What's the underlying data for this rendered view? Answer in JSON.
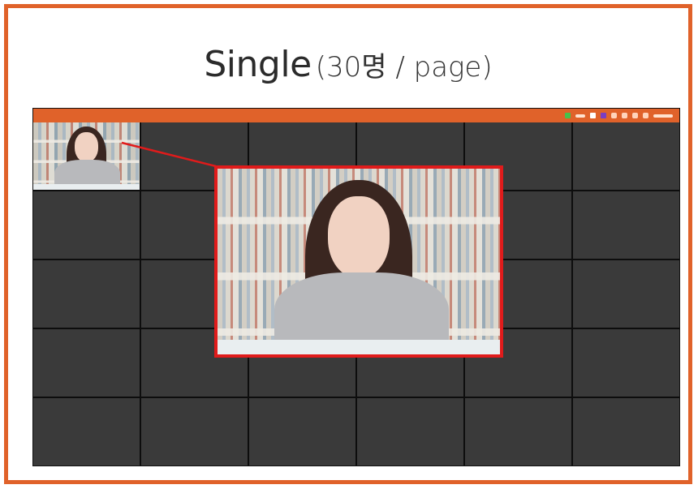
{
  "slide": {
    "title": "Single",
    "subtitle": "(30명 / page)"
  },
  "colors": {
    "frame": "#e0622a",
    "topbar": "#e0622a",
    "tile": "#3a3a3a",
    "highlight": "#e01b1b"
  },
  "screen": {
    "grid": {
      "columns": 6,
      "rows": 5
    },
    "topbar_icons": [
      "status-green-icon",
      "label-icon",
      "white-square-icon",
      "purple-square-icon",
      "mic-icon",
      "camera-icon",
      "share-icon",
      "menu-icon",
      "time-icon"
    ],
    "active_tile": 1
  }
}
